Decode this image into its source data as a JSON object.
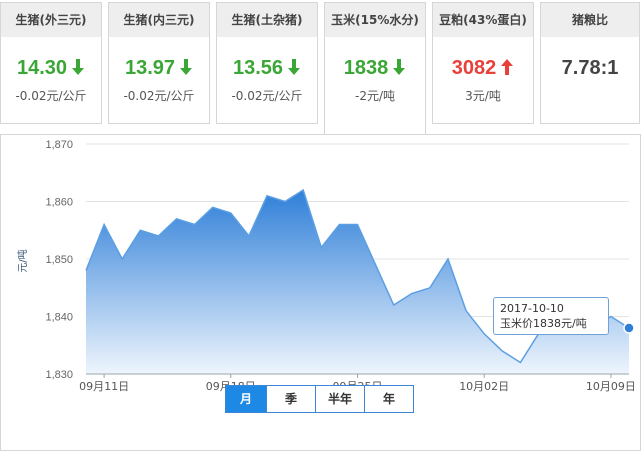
{
  "cards": [
    {
      "title": "生猪(外三元)",
      "value": "14.30",
      "direction": "down",
      "change": "-0.02元/公斤",
      "color": "#3aa635"
    },
    {
      "title": "生猪(内三元)",
      "value": "13.97",
      "direction": "down",
      "change": "-0.02元/公斤",
      "color": "#3aa635"
    },
    {
      "title": "生猪(土杂猪)",
      "value": "13.56",
      "direction": "down",
      "change": "-0.02元/公斤",
      "color": "#3aa635"
    },
    {
      "title": "玉米(15%水分)",
      "value": "1838",
      "direction": "down",
      "change": "-2元/吨",
      "color": "#3aa635"
    },
    {
      "title": "豆粕(43%蛋白)",
      "value": "3082",
      "direction": "up",
      "change": "3元/吨",
      "color": "#e8413b"
    },
    {
      "title": "猪粮比",
      "value": "7.78:1",
      "direction": "none",
      "change": "",
      "color": "#444444"
    }
  ],
  "active_card_index": 3,
  "chart_data": {
    "type": "area",
    "title": "",
    "xlabel": "",
    "ylabel": "元/吨",
    "ylim": [
      1830,
      1870
    ],
    "y_ticks": [
      "1,870",
      "1,860",
      "1,850",
      "1,840",
      "1,830"
    ],
    "y_tick_values": [
      1870,
      1860,
      1850,
      1840,
      1830
    ],
    "x_tick_labels": [
      "09月11日",
      "09月18日",
      "09月25日",
      "10月02日",
      "10月09日"
    ],
    "x_tick_dates": [
      "2017-09-11",
      "2017-09-18",
      "2017-09-25",
      "2017-10-02",
      "2017-10-09"
    ],
    "grid": true,
    "colors": {
      "fill_top": "#2f7fd8",
      "fill_bottom": "#eef5fd",
      "line": "#5b9fe3",
      "marker": "#2f7fd8"
    },
    "series": [
      {
        "x": [
          "2017-09-10",
          "2017-09-11",
          "2017-09-12",
          "2017-09-13",
          "2017-09-14",
          "2017-09-15",
          "2017-09-16",
          "2017-09-17",
          "2017-09-18",
          "2017-09-19",
          "2017-09-20",
          "2017-09-21",
          "2017-09-22",
          "2017-09-23",
          "2017-09-24",
          "2017-09-25",
          "2017-09-26",
          "2017-09-27",
          "2017-09-28",
          "2017-09-29",
          "2017-09-30",
          "2017-10-01",
          "2017-10-02",
          "2017-10-03",
          "2017-10-04",
          "2017-10-05",
          "2017-10-06",
          "2017-10-07",
          "2017-10-08",
          "2017-10-09",
          "2017-10-10"
        ],
        "values": [
          1848,
          1856,
          1850,
          1855,
          1854,
          1857,
          1856,
          1859,
          1858,
          1854,
          1861,
          1860,
          1862,
          1852,
          1856,
          1856,
          1849,
          1842,
          1844,
          1845,
          1850,
          1841,
          1837,
          1834,
          1832,
          1837,
          1838,
          1838,
          1838,
          1840,
          1838
        ]
      }
    ],
    "highlight_index": 30
  },
  "tooltip": {
    "date": "2017-10-10",
    "text": "玉米价1838元/吨"
  },
  "ranges": [
    {
      "label": "月",
      "selected": true
    },
    {
      "label": "季",
      "selected": false
    },
    {
      "label": "半年",
      "selected": false
    },
    {
      "label": "年",
      "selected": false
    }
  ]
}
